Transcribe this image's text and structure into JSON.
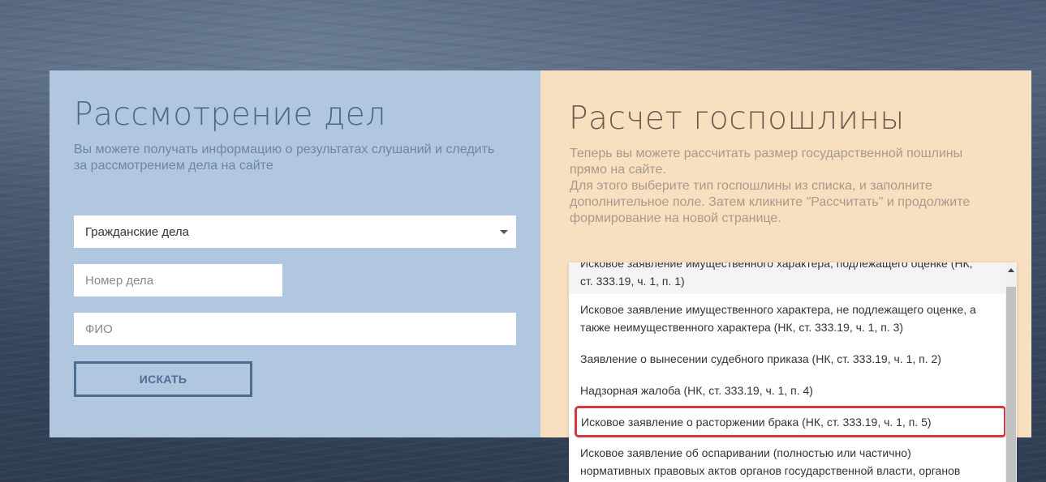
{
  "case_review": {
    "title": "Рассмотрение дел",
    "subtitle_lines": [
      "Вы можете получать информацию о результатах слушаний и следить",
      "за рассмотрением дела на сайте"
    ],
    "case_type_selected": "Гражданские дела",
    "case_number_placeholder": "Номер дела",
    "fio_placeholder": "ФИО",
    "search_label": "ИСКАТЬ"
  },
  "fee_calc": {
    "title": "Расчет госпошлины",
    "description_lines": [
      "Теперь вы можете рассчитать размер государственной пошлины",
      "прямо на сайте.",
      "Для этого выберите тип госпошлины из списка, и заполните",
      "дополнительное поле. Затем кликните \"Рассчитать\" и продолжите",
      "формирование на новой странице."
    ],
    "options": [
      {
        "lines": [
          "Исковое заявление имущественного характера, подлежащего оценке (НК,",
          "ст. 333.19, ч. 1, п. 1)"
        ]
      },
      {
        "lines": [
          "Исковое заявление имущественного характера, не подлежащего оценке, а",
          "также неимущественного характера (НК, ст. 333.19, ч. 1, п. 3)"
        ]
      },
      {
        "lines": [
          "Заявление о вынесении судебного приказа (НК, ст. 333.19, ч. 1, п. 2)"
        ]
      },
      {
        "lines": [
          "Надзорная жалоба (НК, ст. 333.19, ч. 1, п. 4)"
        ]
      },
      {
        "lines": [
          "Исковое заявление о расторжении брака (НК, ст. 333.19, ч. 1, п. 5)"
        ]
      },
      {
        "lines": [
          "Исковое заявление об оспаривании (полностью или частично)",
          "нормативных правовых актов органов государственной власти, органов"
        ]
      }
    ],
    "highlighted_option_index": 4
  },
  "colors": {
    "left_panel": "#b1c7df",
    "right_panel": "#f8dfc0",
    "highlight_border": "#d6393b"
  }
}
